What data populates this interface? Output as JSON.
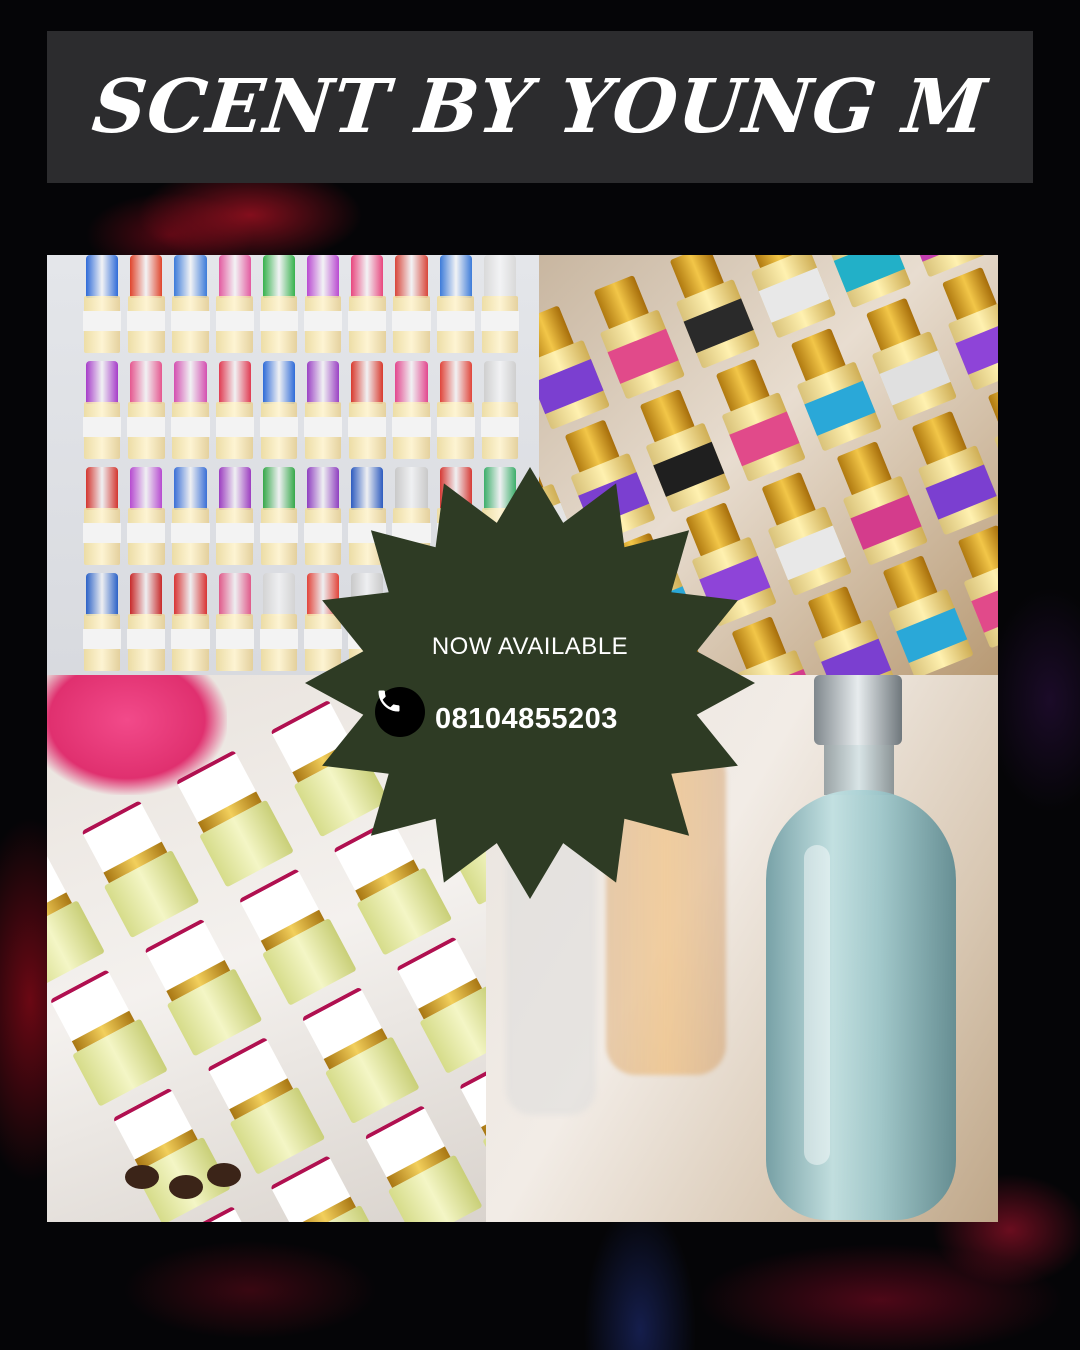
{
  "banner": {
    "title": "SCENT BY YOUNG  M"
  },
  "badge": {
    "tagline": "NOW AVAILABLE",
    "phone": "08104855203",
    "icon": "phone-icon",
    "color": "#2e3b24"
  },
  "colors": {
    "background": "#050507",
    "banner": "#2c2c2e",
    "smoke": "#c8142a"
  }
}
